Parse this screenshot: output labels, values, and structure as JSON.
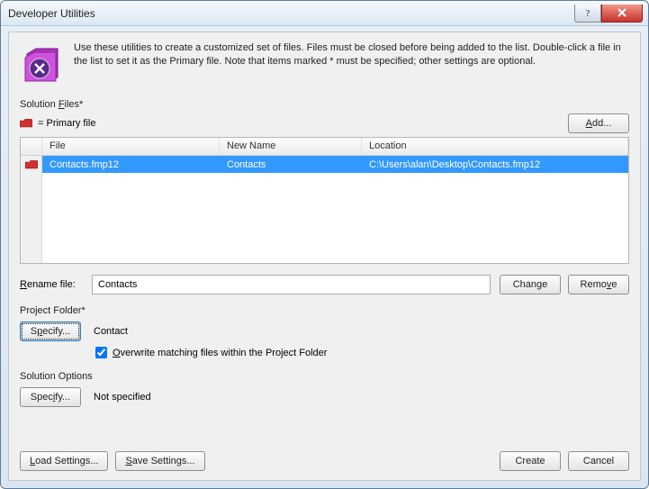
{
  "titlebar": {
    "title": "Developer Utilities"
  },
  "intro": {
    "text": "Use these utilities to create a customized set of files. Files must be closed before being added to the list. Double-click a file in the list to set it as the Primary file. Note that items marked * must be specified; other settings are optional."
  },
  "solution_files": {
    "label": "Solution Files*",
    "legend": "= Primary file",
    "add_button": "Add...",
    "columns": {
      "file": "File",
      "newname": "New Name",
      "location": "Location"
    },
    "rows": [
      {
        "file": "Contacts.fmp12",
        "newname": "Contacts",
        "location": "C:\\Users\\alan\\Desktop\\Contacts.fmp12",
        "primary": true
      }
    ]
  },
  "rename": {
    "label": "Rename file:",
    "value": "Contacts",
    "change": "Change",
    "remove": "Remove"
  },
  "project_folder": {
    "label": "Project Folder*",
    "specify": "Specify...",
    "path": "Contact",
    "overwrite_label": "Overwrite matching files within the Project Folder",
    "overwrite_checked": true
  },
  "solution_options": {
    "label": "Solution Options",
    "specify": "Specify...",
    "status": "Not specified"
  },
  "footer": {
    "load": "Load Settings...",
    "save": "Save Settings...",
    "create": "Create",
    "cancel": "Cancel"
  }
}
